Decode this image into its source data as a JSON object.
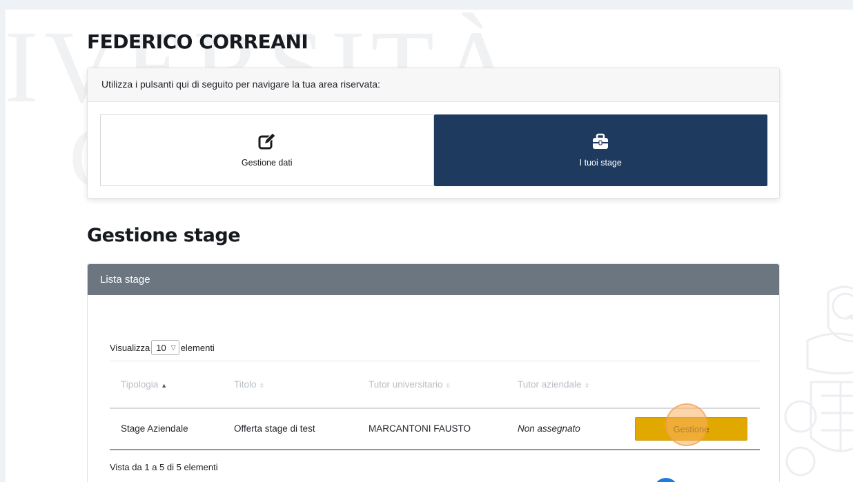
{
  "header": {
    "user_name": "FEDERICO CORREANI"
  },
  "nav_card": {
    "instruction": "Utilizza i pulsanti qui di seguito per navigare la tua area riservata:",
    "buttons": [
      {
        "label": "Gestione dati",
        "icon": "edit-icon",
        "active": false
      },
      {
        "label": "I tuoi stage",
        "icon": "briefcase-icon",
        "active": true
      }
    ]
  },
  "section": {
    "title": "Gestione stage"
  },
  "list": {
    "header": "Lista stage",
    "length_prefix": "Visualizza",
    "length_value": "10",
    "length_suffix": "elementi",
    "columns": [
      "Tipologia",
      "Titolo",
      "Tutor universitario",
      "Tutor aziendale"
    ],
    "sorted_column": "Tipologia",
    "rows": [
      {
        "tipologia": "Stage Aziendale",
        "titolo": "Offerta stage di test",
        "tutor_universitario": "MARCANTONI FAUSTO",
        "tutor_aziendale": "Non assegnato",
        "action_label": "Gestione"
      }
    ],
    "info": "Vista da 1 a 5 di 5 elementi"
  },
  "colors": {
    "primary_dark": "#1e3a5f",
    "card_header_grey": "#6b7681",
    "action_yellow": "#e1a800",
    "pagination_blue": "#1f7ae0"
  }
}
